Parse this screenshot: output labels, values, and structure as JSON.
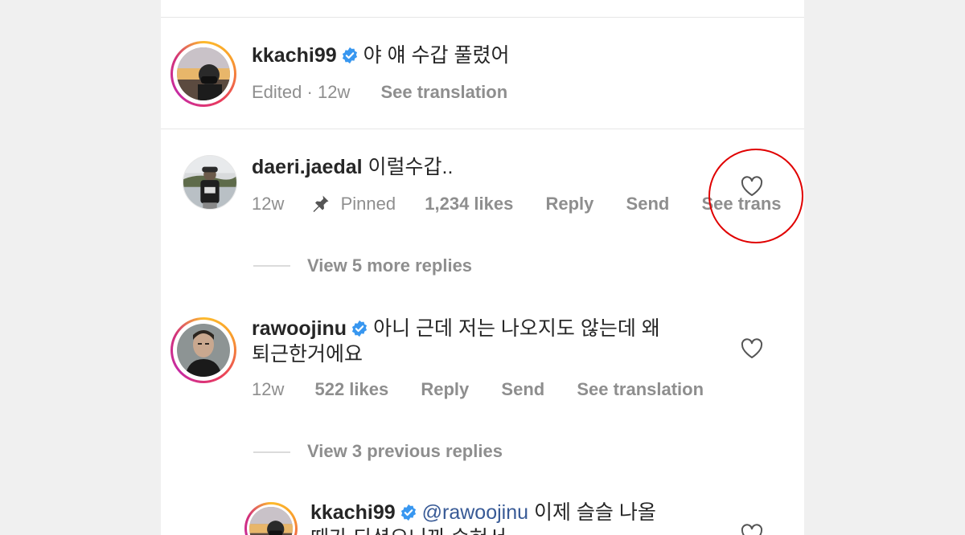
{
  "comments": [
    {
      "username": "kkachi99",
      "verified": true,
      "text": "야 얘 수갑 풀렸어",
      "edited": "Edited",
      "dot": "·",
      "time": "12w",
      "see_translation": "See translation"
    },
    {
      "username": "daeri.jaedal",
      "verified": false,
      "text": "이럴수갑..",
      "time": "12w",
      "pinned": "Pinned",
      "likes": "1,234 likes",
      "reply": "Reply",
      "send": "Send",
      "see_translation": "See trans"
    },
    {
      "username": "rawoojinu",
      "verified": true,
      "text_line1": "아니 근데 저는 나오지도 않는데 왜",
      "text_line2": "퇴근한거에요",
      "time": "12w",
      "likes": "522 likes",
      "reply": "Reply",
      "send": "Send",
      "see_translation": "See translation"
    },
    {
      "username": "kkachi99",
      "verified": true,
      "mention": "@rawoojinu",
      "text_line1": "이제 슬슬 나올",
      "text_line2_partial": "때가 되셨으니까 숭혀서"
    }
  ],
  "view_more_replies": "View 5 more replies",
  "view_previous_replies": "View 3 previous replies",
  "colors": {
    "badge": "#3897f0",
    "secondary_text": "#8e8e8e",
    "mention": "#385a96",
    "highlight_circle": "#e00000"
  },
  "icons": [
    "verified-badge-icon",
    "pin-icon",
    "heart-icon"
  ]
}
